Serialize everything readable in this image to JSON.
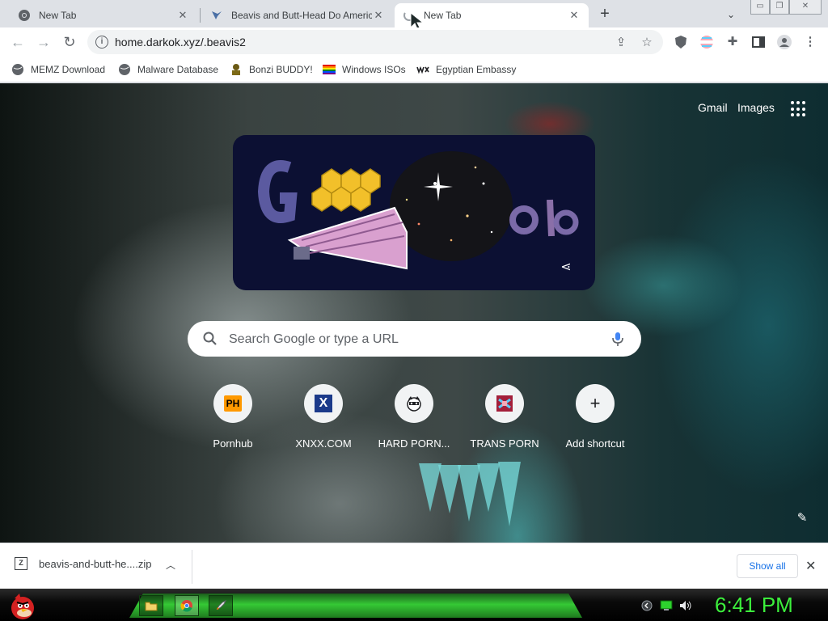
{
  "tabs": [
    {
      "title": "New Tab",
      "close": "✕"
    },
    {
      "title": "Beavis and Butt-Head Do America",
      "close": "✕"
    },
    {
      "title": "New Tab",
      "close": "✕"
    }
  ],
  "tabstrip": {
    "new_tab": "+",
    "tab_search": "⌄"
  },
  "window_controls": {
    "minimize": "▭",
    "restore": "❐",
    "close": "✕"
  },
  "toolbar": {
    "back": "←",
    "forward": "→",
    "reload": "↻",
    "url": "home.darkok.xyz/.beavis2",
    "info": "i"
  },
  "bookmarks": [
    {
      "label": "MEMZ Download"
    },
    {
      "label": "Malware Database"
    },
    {
      "label": "Bonzi BUDDY!"
    },
    {
      "label": "Windows ISOs"
    },
    {
      "label": "Egyptian Embassy"
    }
  ],
  "header_links": {
    "gmail": "Gmail",
    "images": "Images"
  },
  "search": {
    "placeholder": "Search Google or type a URL"
  },
  "shortcuts": [
    {
      "label": "Pornhub",
      "icon_text": "PH"
    },
    {
      "label": "XNXX.COM",
      "icon_text": "X"
    },
    {
      "label": "HARD PORN...",
      "icon_text": ""
    },
    {
      "label": "TRANS PORN",
      "icon_text": ""
    },
    {
      "label": "Add shortcut",
      "icon_text": "+"
    }
  ],
  "downloads": {
    "file": "beavis-and-butt-he....zip",
    "show_all": "Show all",
    "close": "✕",
    "chevron": "︿"
  },
  "taskbar": {
    "clock": "6:41 PM"
  },
  "colors": {
    "accent": "#1a73e8",
    "clock": "#3cf03c",
    "taskbar_glow": "#35c935"
  }
}
